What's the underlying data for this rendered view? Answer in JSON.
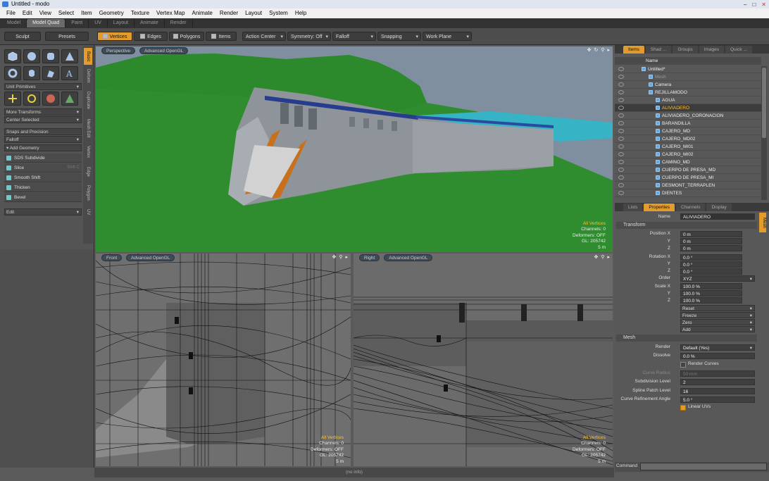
{
  "window": {
    "title": "Untitled - modo",
    "min": "–",
    "max": "□",
    "close": "✕"
  },
  "menu": [
    "File",
    "Edit",
    "View",
    "Select",
    "Item",
    "Geometry",
    "Texture",
    "Vertex Map",
    "Animate",
    "Render",
    "Layout",
    "System",
    "Help"
  ],
  "layout_tabs": [
    "Model",
    "Model Quad",
    "Paint",
    "UV",
    "Layout",
    "Animate",
    "Render"
  ],
  "toolbar": {
    "sculpt": "Sculpt",
    "presets": "Presets",
    "vertices": "Vertices",
    "edges": "Edges",
    "polygons": "Polygons",
    "items": "Items",
    "action_center": "Action Center",
    "symmetry": "Symmetry: Off",
    "falloff": "Falloff",
    "snapping": "Snapping",
    "work_plane": "Work Plane"
  },
  "left": {
    "unit_primitives": "Unit Primitives",
    "more_transforms": "More Transforms",
    "center_selected": "Center Selected",
    "snaps": "Snaps and Precision",
    "falloff": "Falloff",
    "add_geometry": "Add Geometry",
    "tools": [
      {
        "label": "SDS Subdivide",
        "shortcut": ""
      },
      {
        "label": "Slice",
        "shortcut": "Shift C"
      },
      {
        "label": "Smooth Shift",
        "shortcut": ""
      },
      {
        "label": "Thicken",
        "shortcut": ""
      },
      {
        "label": "Bevel",
        "shortcut": ""
      }
    ],
    "edit": "Edit",
    "vtabs": [
      "Basic",
      "Deform",
      "Duplicate",
      "Mesh Edit",
      "Vertex",
      "Edge",
      "Polygon",
      "UV"
    ]
  },
  "viewports": {
    "perspective": {
      "view": "Perspective",
      "shading": "Advanced OpenGL",
      "line1": "All Vertices",
      "line2": "Channels: 0",
      "line3": "Deformers: OFF",
      "line4": "GL: 205742",
      "line5": "5 m"
    },
    "front": {
      "view": "Front",
      "shading": "Advanced OpenGL",
      "line1": "All Vertices",
      "line2": "Channels: 0",
      "line3": "Deformers: OFF",
      "line4": "GL: 205742",
      "line5": "5 m"
    },
    "right": {
      "view": "Right",
      "shading": "Advanced OpenGL",
      "line1": "All Vertices",
      "line2": "Channels: 0",
      "line3": "Deformers: OFF",
      "line4": "GL: 205742",
      "line5": "5 m"
    }
  },
  "status": "(no info)",
  "items_panel": {
    "tabs": [
      "Items",
      "Shad ...",
      "Groups",
      "Images",
      "Quick ..."
    ],
    "name_header": "Name",
    "rows": [
      {
        "label": "Untitled*",
        "indent": 0
      },
      {
        "label": "Mesh",
        "indent": 1
      },
      {
        "label": "Camera",
        "indent": 1
      },
      {
        "label": "REJILLAMODO",
        "indent": 1
      },
      {
        "label": "AGUA",
        "indent": 2
      },
      {
        "label": "ALIVIADERO",
        "indent": 2
      },
      {
        "label": "ALIVIADERO_CORONACION",
        "indent": 2
      },
      {
        "label": "BARANDILLA",
        "indent": 2
      },
      {
        "label": "CAJERO_MD",
        "indent": 2
      },
      {
        "label": "CAJERO_MD02",
        "indent": 2
      },
      {
        "label": "CAJERO_MI01",
        "indent": 2
      },
      {
        "label": "CAJERO_MI02",
        "indent": 2
      },
      {
        "label": "CAMINO_MD",
        "indent": 2
      },
      {
        "label": "CUERPO DE PRESA_MD",
        "indent": 2
      },
      {
        "label": "CUERPO DE PRESA_MI",
        "indent": 2
      },
      {
        "label": "DESMONT_TERRAPLEN",
        "indent": 2
      },
      {
        "label": "DIENTES",
        "indent": 2
      }
    ]
  },
  "props_panel": {
    "tabs": [
      "Lists",
      "Properties",
      "Channels",
      "Display"
    ],
    "side_tab": "Mesh",
    "name_label": "Name",
    "name_value": "ALIVIADERO",
    "transform": "Transform",
    "pos_x": "Position X",
    "pos_y": "Y",
    "pos_z": "Z",
    "pos_vals": [
      "0 m",
      "0 m",
      "0 m"
    ],
    "rot_x": "Rotation X",
    "rot_y": "Y",
    "rot_z": "Z",
    "rot_vals": [
      "0.0 °",
      "0.0 °",
      "0.0 °"
    ],
    "order_label": "Order",
    "order_value": "XYZ",
    "scale_x": "Scale X",
    "scale_y": "Y",
    "scale_z": "Z",
    "scale_vals": [
      "100.0 %",
      "100.0 %",
      "100.0 %"
    ],
    "actions": [
      "Reset",
      "Freeze",
      "Zero",
      "Add"
    ],
    "mesh": "Mesh",
    "render_label": "Render",
    "render_value": "Default (Yes)",
    "dissolve_label": "Dissolve",
    "dissolve_value": "0.0 %",
    "render_curves": "Render Curves",
    "curve_radius_label": "Curve Radius",
    "curve_radius_value": "50 mm",
    "subdiv_label": "Subdivision Level",
    "subdiv_value": "2",
    "spline_label": "Spline Patch Level",
    "spline_value": "16",
    "curve_ref_label": "Curve Refinement Angle",
    "curve_ref_value": "5.0 °",
    "linear_uvs": "Linear UVs"
  },
  "command": {
    "label": "Command"
  }
}
